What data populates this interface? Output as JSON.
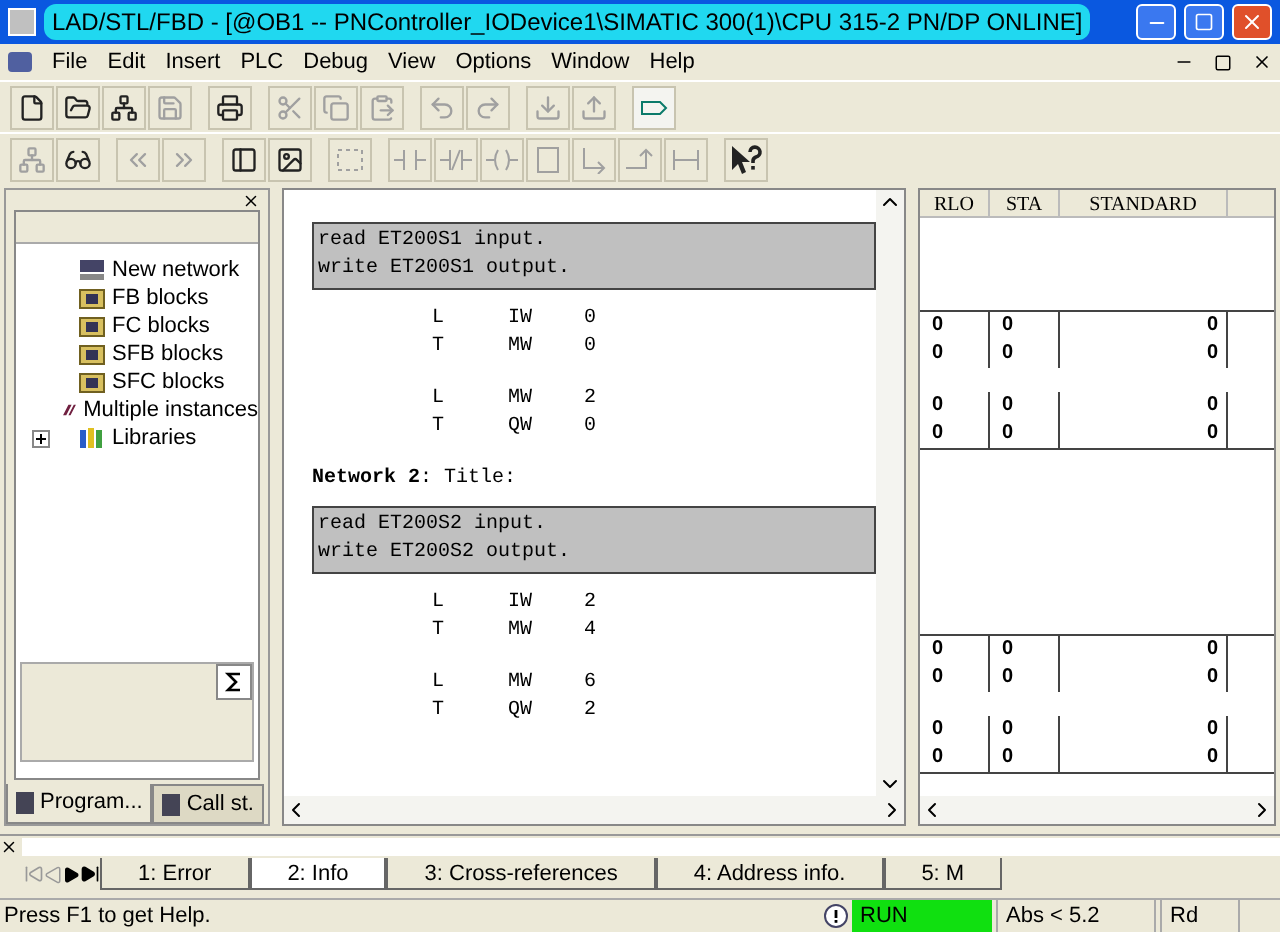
{
  "window": {
    "title": "LAD/STL/FBD  - [@OB1 -- PNController_IODevice1\\SIMATIC 300(1)\\CPU 315-2 PN/DP  ONLINE]"
  },
  "menu": [
    "File",
    "Edit",
    "Insert",
    "PLC",
    "Debug",
    "View",
    "Options",
    "Window",
    "Help"
  ],
  "toolbar_rows": [
    [
      {
        "kind": "new",
        "disabled": false
      },
      {
        "kind": "open",
        "disabled": false
      },
      {
        "kind": "nodes",
        "disabled": false
      },
      {
        "kind": "save",
        "disabled": true
      },
      {
        "kind": "sep"
      },
      {
        "kind": "print",
        "disabled": false
      },
      {
        "kind": "sep"
      },
      {
        "kind": "cut",
        "disabled": true
      },
      {
        "kind": "copy",
        "disabled": true
      },
      {
        "kind": "paste",
        "disabled": true
      },
      {
        "kind": "sep"
      },
      {
        "kind": "undo",
        "disabled": true
      },
      {
        "kind": "redo",
        "disabled": true
      },
      {
        "kind": "sep"
      },
      {
        "kind": "download",
        "disabled": true
      },
      {
        "kind": "upload",
        "disabled": true
      },
      {
        "kind": "sep"
      },
      {
        "kind": "monitor",
        "disabled": false
      }
    ],
    [
      {
        "kind": "overview",
        "disabled": true
      },
      {
        "kind": "glasses",
        "disabled": false
      },
      {
        "kind": "sep"
      },
      {
        "kind": "prev",
        "disabled": true
      },
      {
        "kind": "next",
        "disabled": true
      },
      {
        "kind": "sep"
      },
      {
        "kind": "panel",
        "disabled": false
      },
      {
        "kind": "image",
        "disabled": false
      },
      {
        "kind": "sep"
      },
      {
        "kind": "network",
        "disabled": true
      },
      {
        "kind": "sep"
      },
      {
        "kind": "contact",
        "disabled": true
      },
      {
        "kind": "ncontact",
        "disabled": true
      },
      {
        "kind": "coil",
        "disabled": true
      },
      {
        "kind": "box",
        "disabled": true
      },
      {
        "kind": "branch",
        "disabled": true
      },
      {
        "kind": "close-branch",
        "disabled": true
      },
      {
        "kind": "connect",
        "disabled": true
      },
      {
        "kind": "sep"
      },
      {
        "kind": "help",
        "disabled": false
      }
    ]
  ],
  "tree": [
    {
      "label": "New network",
      "kind": "network"
    },
    {
      "label": "FB blocks",
      "kind": "folder"
    },
    {
      "label": "FC blocks",
      "kind": "folder"
    },
    {
      "label": "SFB blocks",
      "kind": "folder"
    },
    {
      "label": "SFC blocks",
      "kind": "folder"
    },
    {
      "label": "Multiple instances",
      "kind": "instances"
    },
    {
      "label": "Libraries",
      "kind": "library",
      "expanded": false
    }
  ],
  "left_tabs": [
    {
      "label": "Program...",
      "selected": true
    },
    {
      "label": "Call st.",
      "selected": false
    }
  ],
  "networks": [
    {
      "comment": [
        "read ET200S1 input.",
        "write ET200S1 output."
      ],
      "groups": [
        [
          {
            "op": "L",
            "operand": "IW",
            "address": "0",
            "rlo": "0",
            "sta": "0",
            "standard": "0"
          },
          {
            "op": "T",
            "operand": "MW",
            "address": "0",
            "rlo": "0",
            "sta": "0",
            "standard": "0"
          }
        ],
        [
          {
            "op": "L",
            "operand": "MW",
            "address": "2",
            "rlo": "0",
            "sta": "0",
            "standard": "0"
          },
          {
            "op": "T",
            "operand": "QW",
            "address": "0",
            "rlo": "0",
            "sta": "0",
            "standard": "0"
          }
        ]
      ]
    },
    {
      "title": {
        "name": "Network 2",
        "label": ": Title:"
      },
      "comment": [
        "read ET200S2 input.",
        "write ET200S2 output."
      ],
      "groups": [
        [
          {
            "op": "L",
            "operand": "IW",
            "address": "2",
            "rlo": "0",
            "sta": "0",
            "standard": "0"
          },
          {
            "op": "T",
            "operand": "MW",
            "address": "4",
            "rlo": "0",
            "sta": "0",
            "standard": "0"
          }
        ],
        [
          {
            "op": "L",
            "operand": "MW",
            "address": "6",
            "rlo": "0",
            "sta": "0",
            "standard": "0"
          },
          {
            "op": "T",
            "operand": "QW",
            "address": "2",
            "rlo": "0",
            "sta": "0",
            "standard": "0"
          }
        ]
      ]
    }
  ],
  "status_columns": [
    "RLO",
    "STA",
    "STANDARD"
  ],
  "bottom_tabs": [
    {
      "label": "1: Error",
      "selected": false
    },
    {
      "label": "2: Info",
      "selected": true
    },
    {
      "label": "3: Cross-references",
      "selected": false
    },
    {
      "label": "4: Address info.",
      "selected": false
    },
    {
      "label": "5: M",
      "selected": false
    }
  ],
  "status_bar": {
    "help": "Press F1 to get Help.",
    "mode": "RUN",
    "position": "Abs < 5.2",
    "rd": "Rd"
  }
}
